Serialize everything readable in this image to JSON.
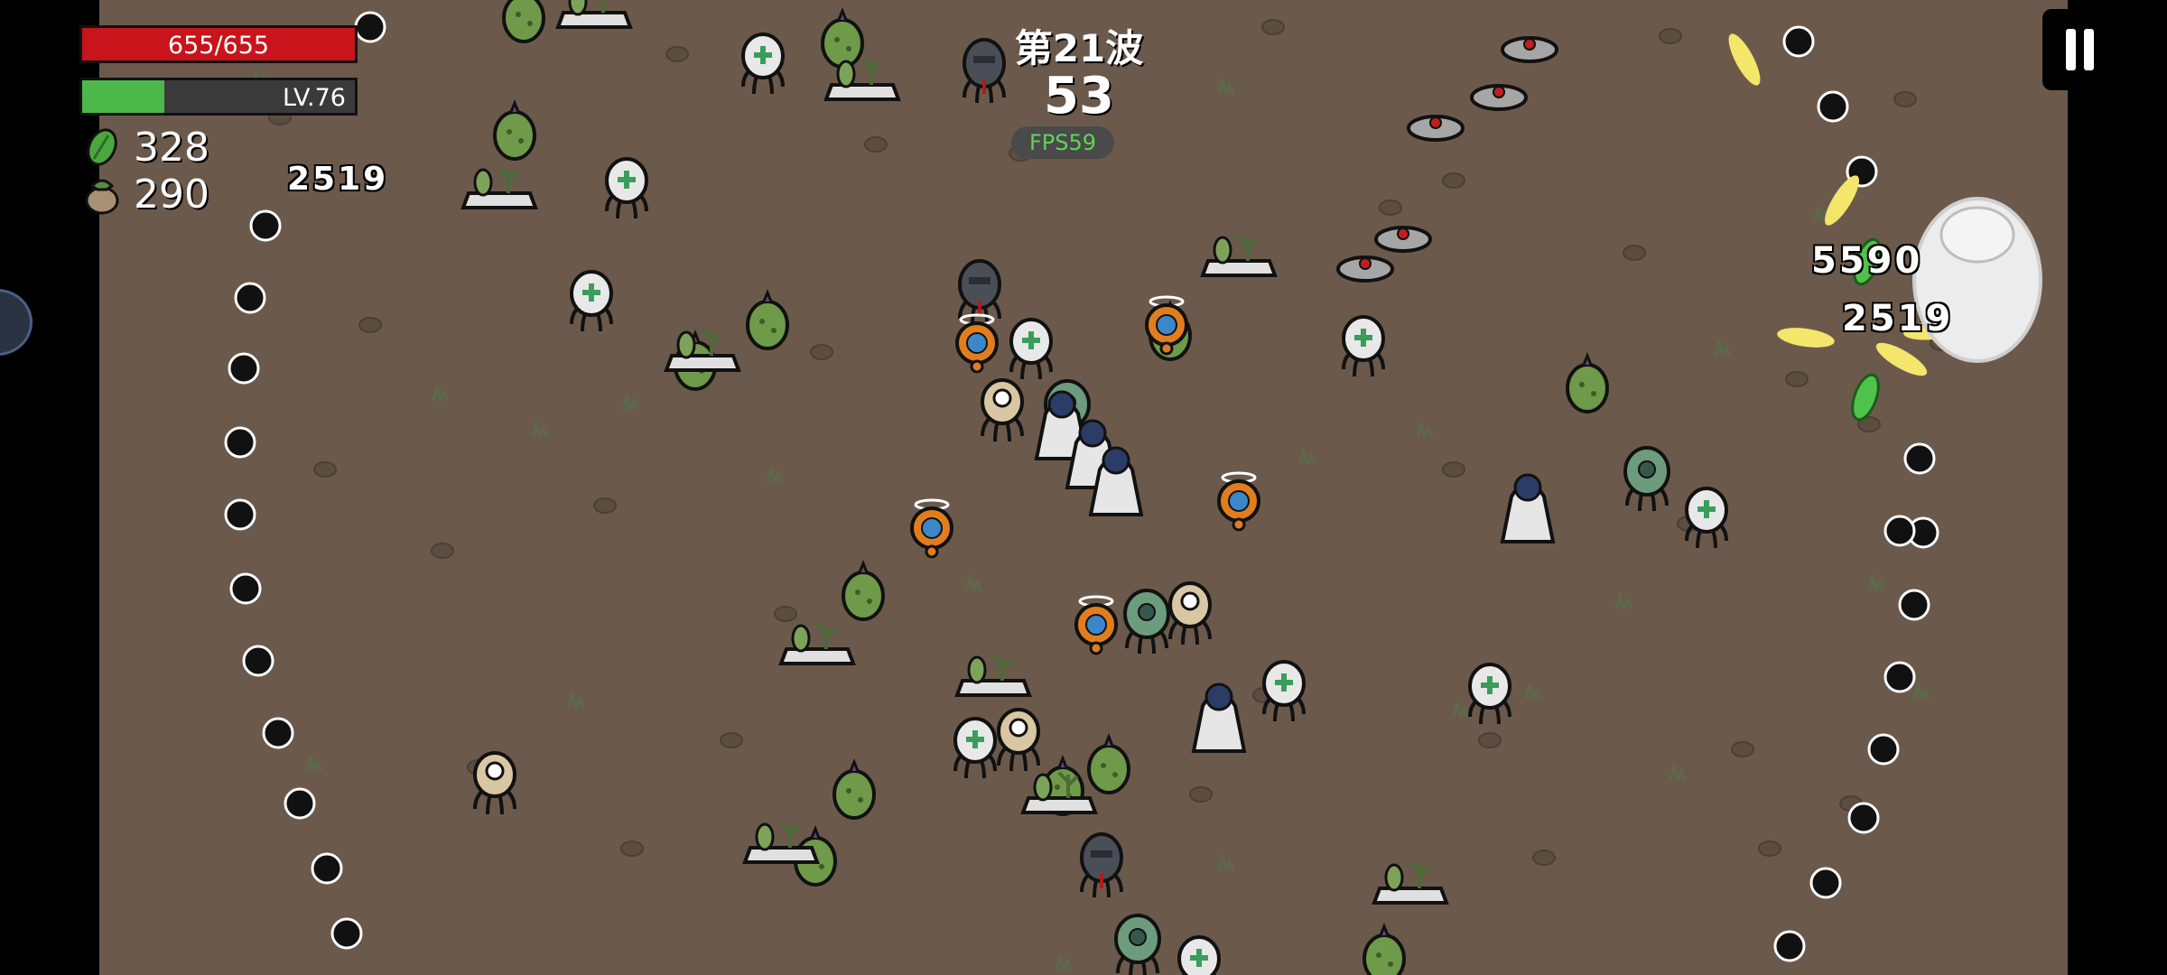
{
  "hud": {
    "hp_text": "655/655",
    "hp_fraction": 1.0,
    "level_text": "LV.76",
    "xp_fraction": 0.3,
    "materials": "328",
    "bag": "290",
    "damage_popup_left": "2519"
  },
  "wave": {
    "title": "第21波",
    "timer": "53",
    "fps": "FPS59"
  },
  "popups": {
    "top": "5590",
    "bottom": "2519"
  },
  "colors": {
    "ground": "#6b5a4c",
    "hp": "#c8141a",
    "xp": "#4db84a",
    "fps_text": "#5fd35a"
  },
  "icons": {
    "material": "green-leaf-icon",
    "bag": "money-bag-icon",
    "pause": "pause-icon"
  }
}
